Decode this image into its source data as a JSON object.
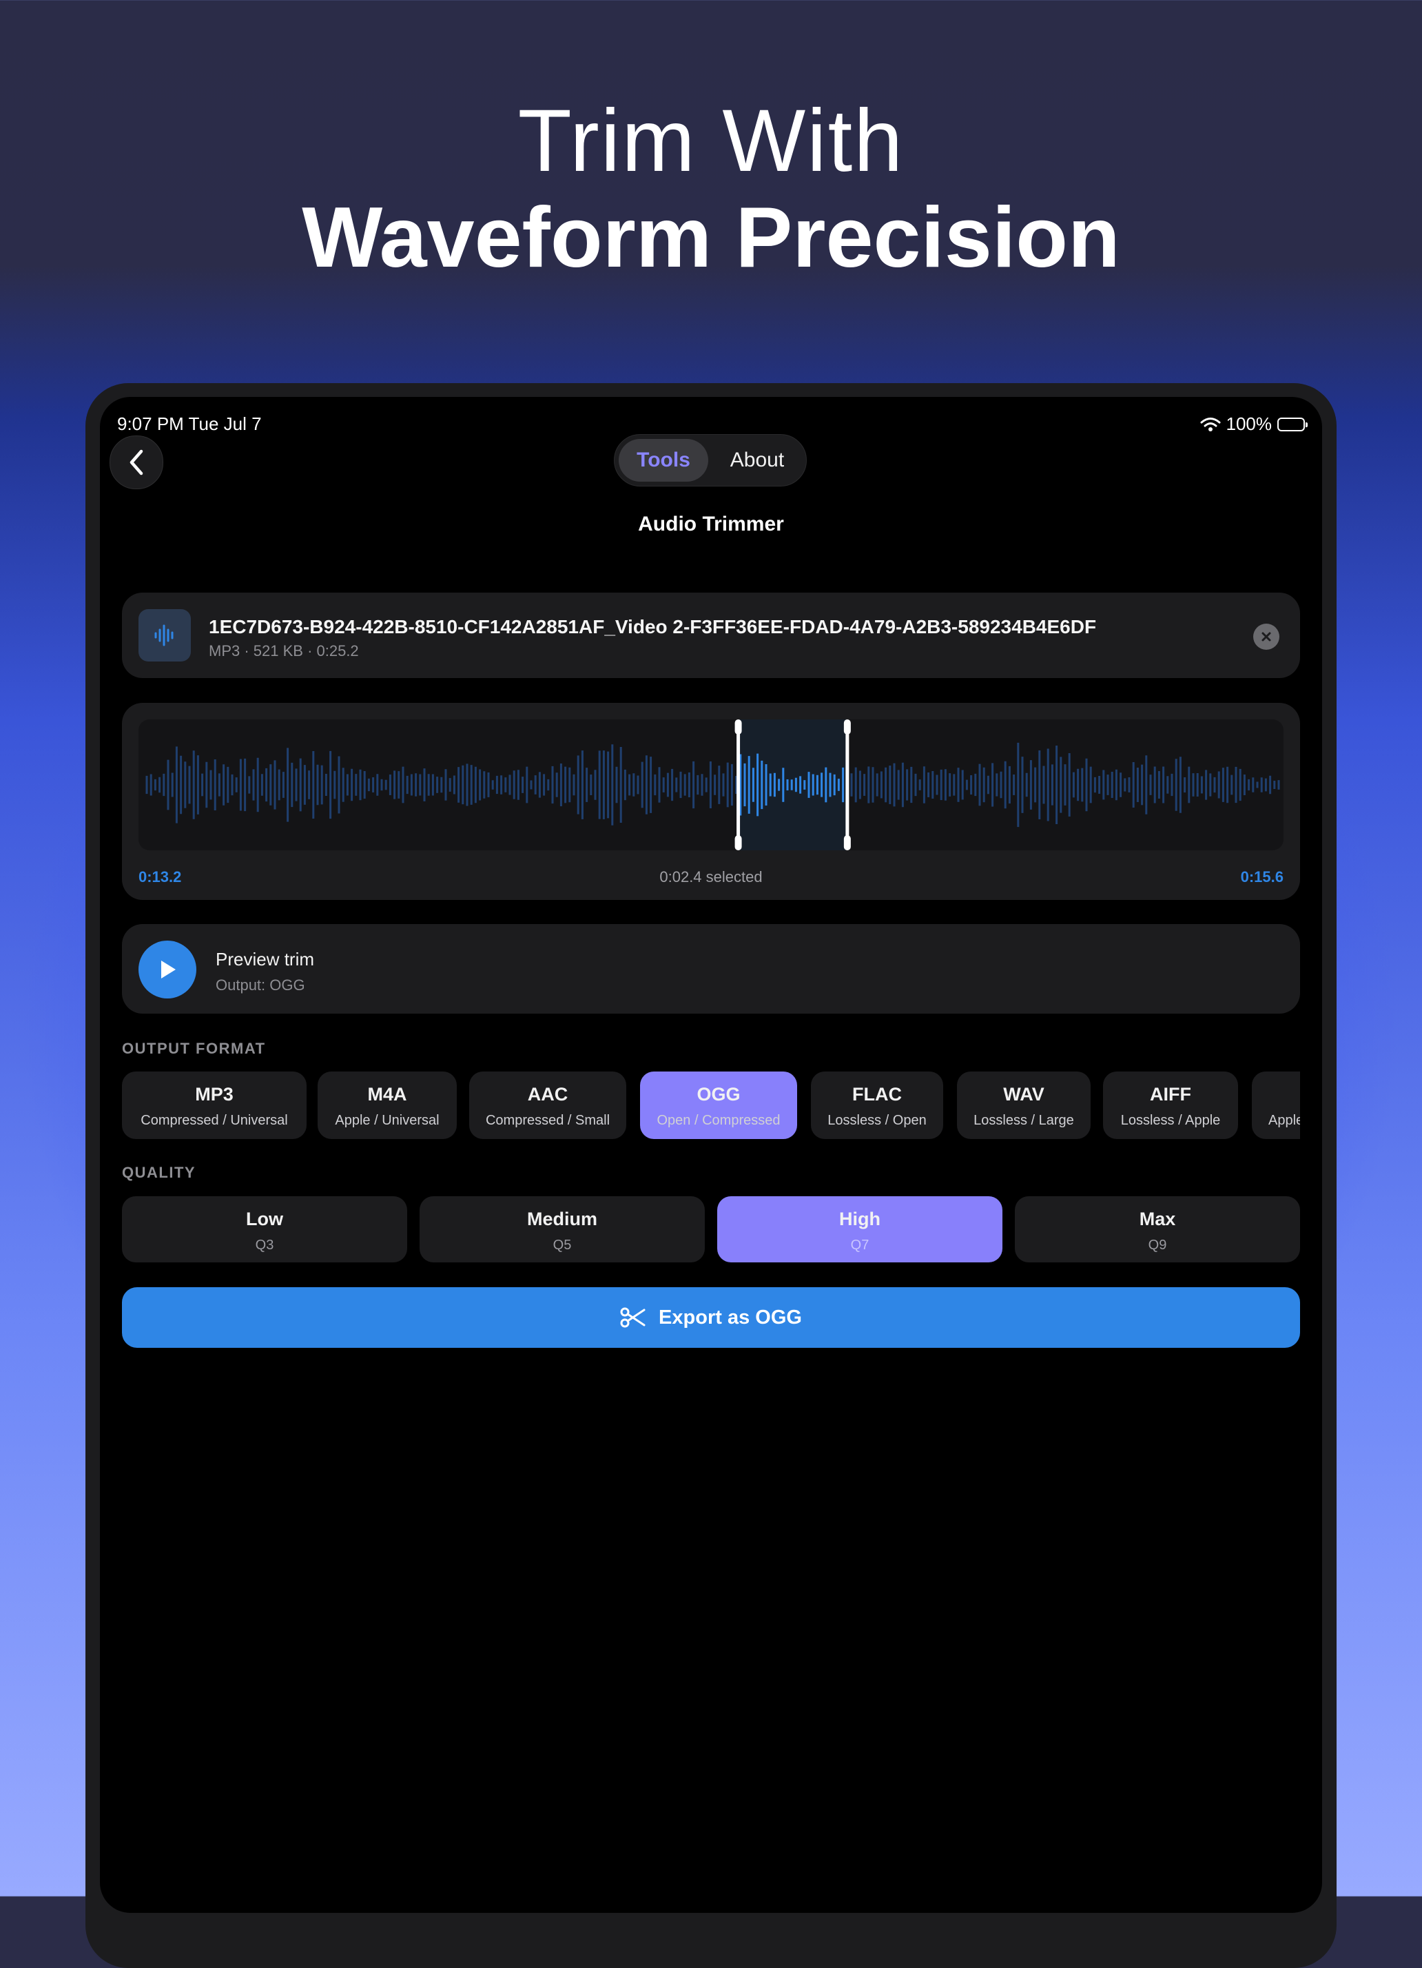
{
  "headline": {
    "line1": "Trim With",
    "line2": "Waveform Precision"
  },
  "status_bar": {
    "time": "9:07 PM  Tue Jul 7",
    "battery": "100%",
    "battery_level": 1.0
  },
  "nav": {
    "back_icon": "chevron-left-icon",
    "tabs": [
      "Tools",
      "About"
    ],
    "selected_tab": "Tools",
    "title": "Audio Trimmer"
  },
  "file": {
    "name": "1EC7D673-B924-422B-8510-CF142A2851AF_Video 2-F3FF36EE-FDAD-4A79-A2B3-589234B4E6DF",
    "meta": "MP3 · 521 KB · 0:25.2",
    "icon": "waveform-icon",
    "clear_icon": "close-circle-icon"
  },
  "trim": {
    "start": "0:13.2",
    "end": "0:15.6",
    "selected": "0:02.4 selected",
    "duration_seconds": 25.2,
    "start_seconds": 13.2,
    "end_seconds": 15.6
  },
  "preview": {
    "title": "Preview trim",
    "subtitle": "Output: OGG",
    "icon": "play-icon"
  },
  "output_format": {
    "label": "OUTPUT FORMAT",
    "options": [
      {
        "name": "MP3",
        "desc": "Compressed / Universal"
      },
      {
        "name": "M4A",
        "desc": "Apple / Universal"
      },
      {
        "name": "AAC",
        "desc": "Compressed / Small"
      },
      {
        "name": "OGG",
        "desc": "Open / Compressed"
      },
      {
        "name": "FLAC",
        "desc": "Lossless / Open"
      },
      {
        "name": "WAV",
        "desc": "Lossless / Large"
      },
      {
        "name": "AIFF",
        "desc": "Lossless / Apple"
      },
      {
        "name": "",
        "desc": "Apple"
      }
    ],
    "selected": "OGG"
  },
  "quality": {
    "label": "QUALITY",
    "options": [
      {
        "name": "Low",
        "sub": "Q3"
      },
      {
        "name": "Medium",
        "sub": "Q5"
      },
      {
        "name": "High",
        "sub": "Q7"
      },
      {
        "name": "Max",
        "sub": "Q9"
      }
    ],
    "selected": "High"
  },
  "export": {
    "label": "Export as OGG",
    "icon": "scissors-icon"
  },
  "colors": {
    "accent_blue": "#2f86e6",
    "selection_purple": "#8880fb",
    "card": "#1c1c1e",
    "waveform_dim": "#1f3f6e",
    "waveform_active": "#2f86e6"
  }
}
